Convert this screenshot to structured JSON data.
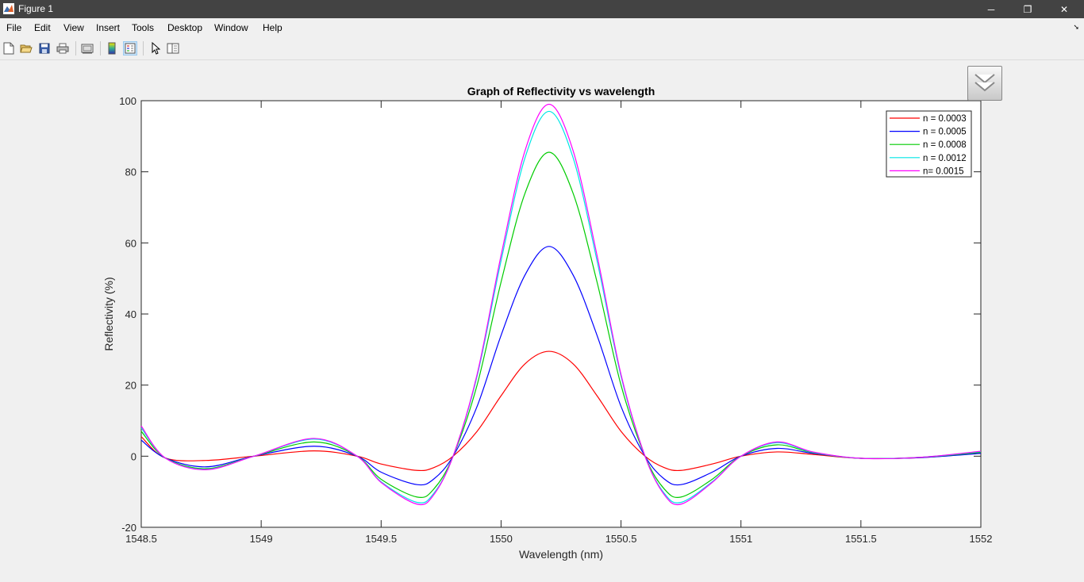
{
  "window": {
    "title": "Figure 1",
    "controls": {
      "minimize": "─",
      "restore": "❐",
      "close": "✕"
    }
  },
  "menu": {
    "items": [
      "File",
      "Edit",
      "View",
      "Insert",
      "Tools",
      "Desktop",
      "Window",
      "Help"
    ]
  },
  "toolbar": {
    "buttons": [
      "new-figure-icon",
      "open-file-icon",
      "save-icon",
      "print-icon",
      "link-plot-icon",
      "colorbar-icon",
      "legend-icon",
      "pointer-icon",
      "property-editor-icon"
    ]
  },
  "chart_data": {
    "type": "line",
    "title": "Graph of Reflectivity vs wavelength",
    "xlabel": "Wavelength (nm)",
    "ylabel": "Reflectivity (%)",
    "xlim": [
      1548.5,
      1552
    ],
    "ylim": [
      -20,
      100
    ],
    "xticks": [
      "1548.5",
      "1549",
      "1549.5",
      "1550",
      "1550.5",
      "1551",
      "1551.5",
      "1552"
    ],
    "yticks": [
      "-20",
      "0",
      "20",
      "40",
      "60",
      "80",
      "100"
    ],
    "legend_position": "top-right",
    "x": [
      1548.5,
      1548.6,
      1548.77,
      1548.97,
      1549.22,
      1549.4,
      1549.5,
      1549.65,
      1549.72,
      1549.8,
      1549.9,
      1550.0,
      1550.1,
      1550.2,
      1550.3,
      1550.4,
      1550.5,
      1550.6,
      1550.68,
      1550.75,
      1550.88,
      1551.0,
      1551.15,
      1551.3,
      1551.5,
      1551.75,
      1552.0
    ],
    "series": [
      {
        "name": "n = 0.0003",
        "color": "#ff0000",
        "values": [
          5.5,
          -0.5,
          -1.2,
          0,
          1.5,
          0,
          -2.2,
          -4,
          -3.2,
          0,
          7,
          17,
          26,
          29.5,
          26,
          17,
          7,
          0,
          -3.2,
          -4,
          -2.2,
          0,
          1.2,
          0.5,
          -0.6,
          -0.4,
          0.9
        ]
      },
      {
        "name": "n = 0.0005",
        "color": "#0000ff",
        "values": [
          4.5,
          -0.5,
          -3,
          0,
          2.8,
          0,
          -4.5,
          -8,
          -6.4,
          0,
          14,
          34,
          51,
          59,
          51,
          34,
          14,
          0,
          -6.4,
          -8,
          -4.5,
          0,
          2.2,
          0.8,
          -0.6,
          -0.4,
          0.8
        ]
      },
      {
        "name": "n = 0.0008",
        "color": "#00cc00",
        "values": [
          7,
          -0.5,
          -3.5,
          0,
          4,
          0,
          -6.5,
          -11.5,
          -9.2,
          0,
          20,
          49,
          74,
          85.5,
          74,
          49,
          20,
          0,
          -9.2,
          -11.5,
          -6.5,
          0,
          3.2,
          1,
          -0.6,
          -0.3,
          1.1
        ]
      },
      {
        "name": "n = 0.0012",
        "color": "#00e5e5",
        "values": [
          8,
          -0.5,
          -3.7,
          0,
          4.8,
          0,
          -7.2,
          -13,
          -10.4,
          0,
          22.5,
          55,
          84,
          97,
          84,
          55,
          22.5,
          0,
          -10.4,
          -13,
          -7.2,
          0,
          3.8,
          1.1,
          -0.6,
          -0.3,
          1.3
        ]
      },
      {
        "name": "n= 0.0015",
        "color": "#ff00ff",
        "values": [
          8.5,
          -0.5,
          -3.8,
          0,
          5,
          0,
          -7.4,
          -13.5,
          -10.8,
          0,
          23,
          56.5,
          86,
          99,
          86,
          56.5,
          23,
          0,
          -10.8,
          -13.5,
          -7.4,
          0,
          4,
          1.2,
          -0.6,
          -0.3,
          1.4
        ]
      }
    ]
  }
}
